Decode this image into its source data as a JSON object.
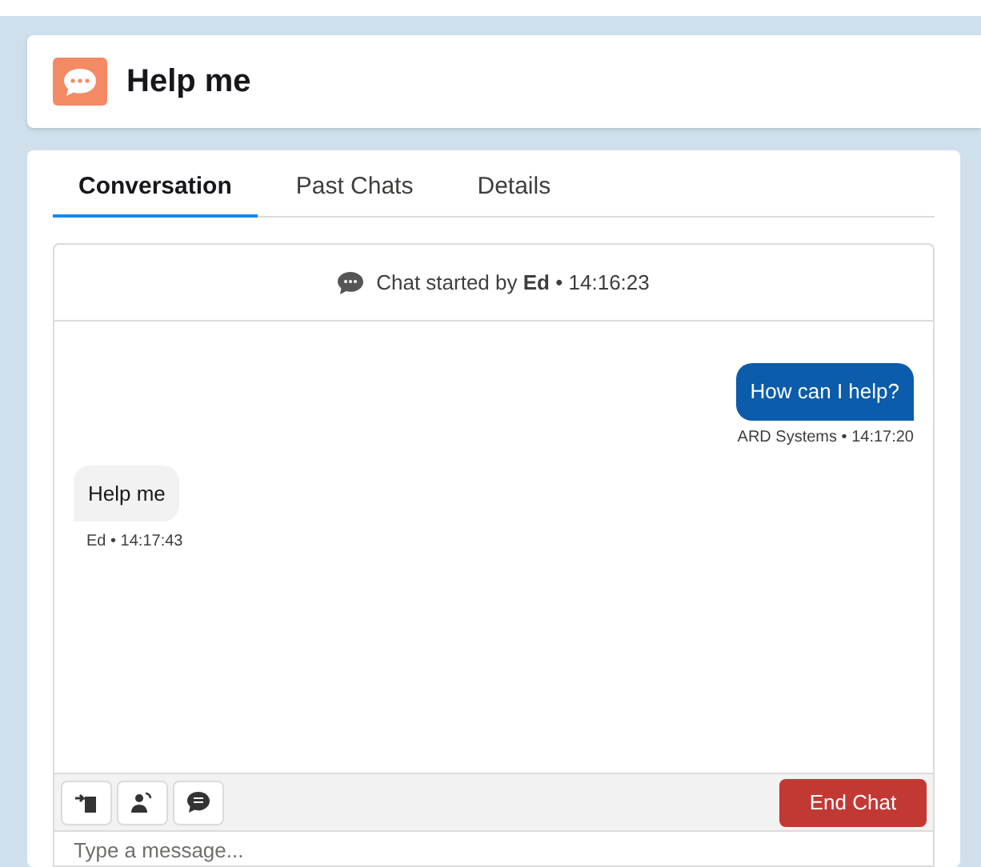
{
  "header": {
    "title": "Help me"
  },
  "tabs": [
    {
      "label": "Conversation",
      "selected": true
    },
    {
      "label": "Past Chats",
      "selected": false
    },
    {
      "label": "Details",
      "selected": false
    }
  ],
  "chat_start": "Chat started by **Ed** • 14:16:23",
  "messages": [
    {
      "kind": "outgoing",
      "text": "How can I help?",
      "meta": "ARD Systems • 14:17:20"
    },
    {
      "kind": "incoming",
      "text": "Help me",
      "meta": "Ed • 14:17:43"
    }
  ],
  "end_button": "End Chat",
  "composer": {
    "placeholder": "Type a message..."
  }
}
